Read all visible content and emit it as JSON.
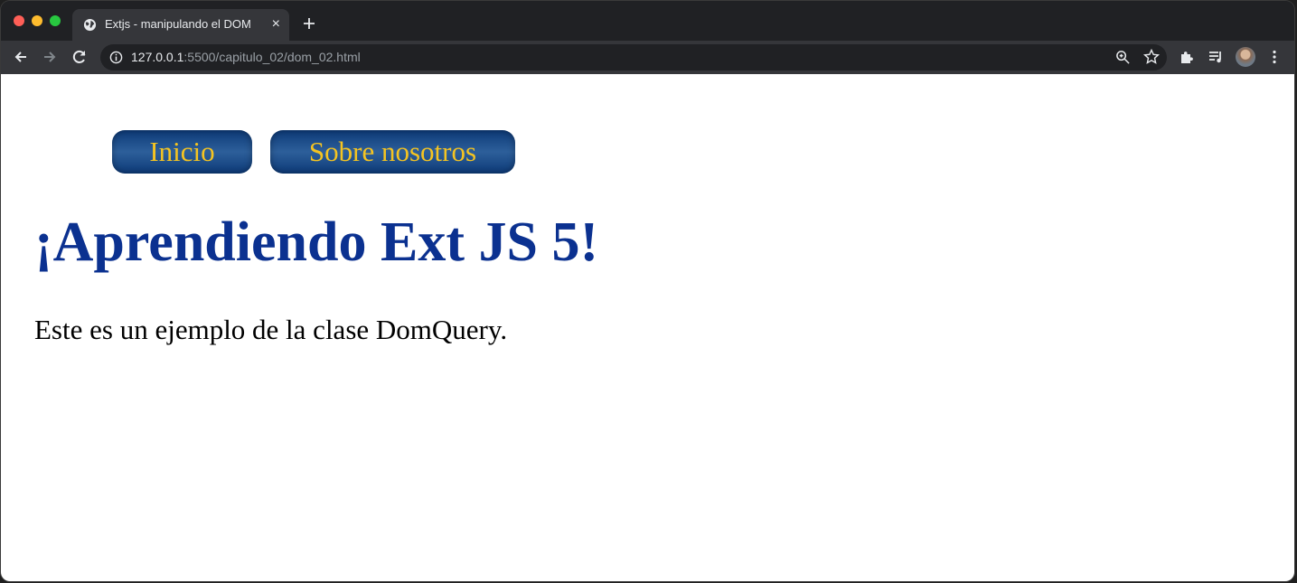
{
  "browser": {
    "tab_title": "Extjs - manipulando el DOM",
    "tab_close": "×",
    "url_host": "127.0.0.1",
    "url_rest": ":5500/capitulo_02/dom_02.html"
  },
  "page": {
    "nav": [
      {
        "label": "Inicio"
      },
      {
        "label": "Sobre nosotros"
      }
    ],
    "heading": "¡Aprendiendo Ext JS 5!",
    "paragraph": "Este es un ejemplo de la clase DomQuery."
  },
  "colors": {
    "heading": "#0b3190",
    "button_text": "#f5c421",
    "button_bg": "#0d3a78"
  },
  "icons": [
    "globe-icon",
    "close-icon",
    "plus-icon",
    "back-arrow-icon",
    "forward-arrow-icon",
    "reload-icon",
    "info-icon",
    "zoom-icon",
    "star-icon",
    "puzzle-icon",
    "media-queue-icon",
    "avatar",
    "kebab-menu-icon"
  ]
}
